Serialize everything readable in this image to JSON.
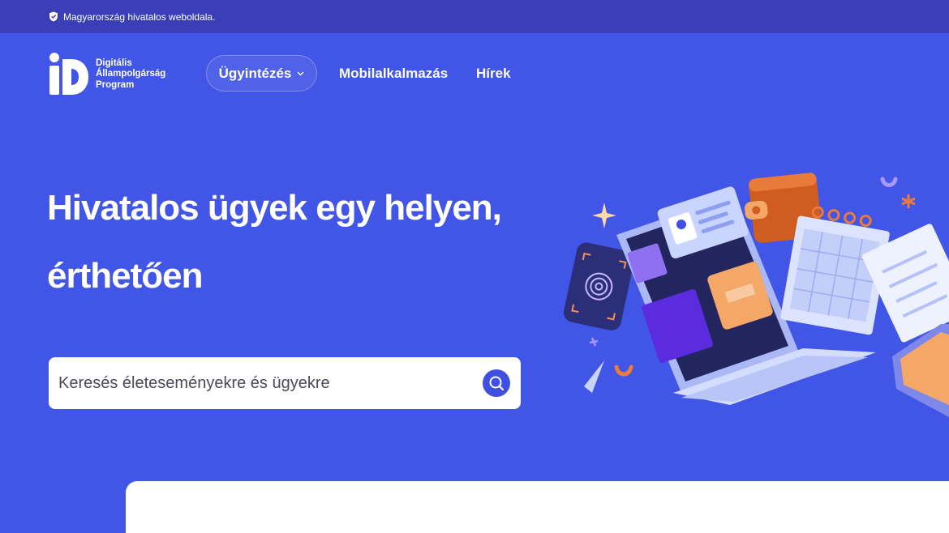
{
  "topbar": {
    "official_text": "Magyarország hivatalos weboldala.",
    "icon": "shield-check-icon"
  },
  "logo": {
    "mark": "iD",
    "lines": [
      "Digitális",
      "Állampolgárság",
      "Program"
    ]
  },
  "nav": {
    "items": [
      {
        "label": "Ügyintézés",
        "has_dropdown": true,
        "icon": "chevron-down-icon"
      },
      {
        "label": "Mobilalkalmazás"
      },
      {
        "label": "Hírek"
      }
    ]
  },
  "hero": {
    "title_line1": "Hivatalos ügyek egy helyen,",
    "title_line2": "érthetően"
  },
  "search": {
    "placeholder": "Keresés életeseményekre és ügyekre",
    "icon": "search-icon"
  },
  "colors": {
    "background": "#4155e6",
    "topbar": "#3a3fb8",
    "accent": "#3f4fe0",
    "card": "#ffffff"
  }
}
